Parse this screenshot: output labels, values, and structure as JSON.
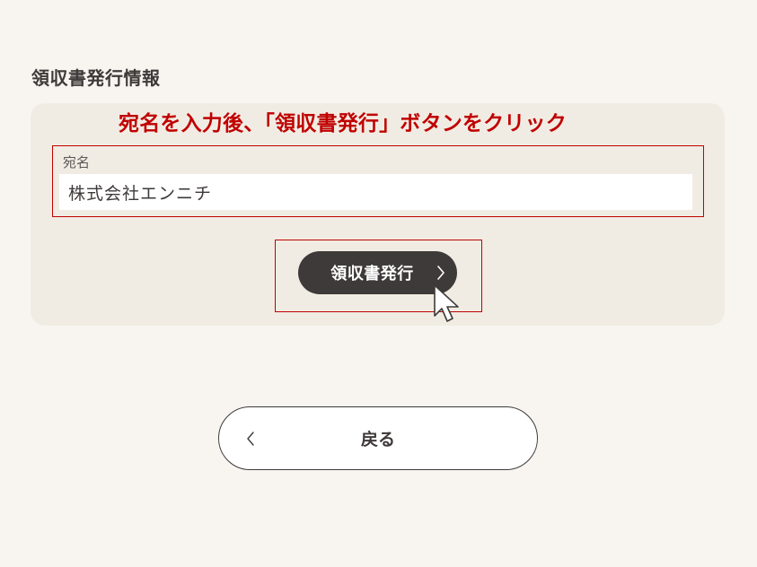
{
  "section": {
    "title": "領収書発行情報"
  },
  "instruction": {
    "text": "宛名を入力後、「領収書発行」ボタンをクリック",
    "color": "#c00000"
  },
  "recipient_field": {
    "label": "宛名",
    "value": "株式会社エンニチ"
  },
  "issue_button": {
    "label": "領収書発行",
    "icon": "chevron-right-icon"
  },
  "back_button": {
    "label": "戻る",
    "icon": "chevron-left-icon"
  },
  "colors": {
    "background": "#f8f5f0",
    "panel": "#f1ece3",
    "primary_button": "#3e3a39",
    "highlight": "#c00000"
  }
}
